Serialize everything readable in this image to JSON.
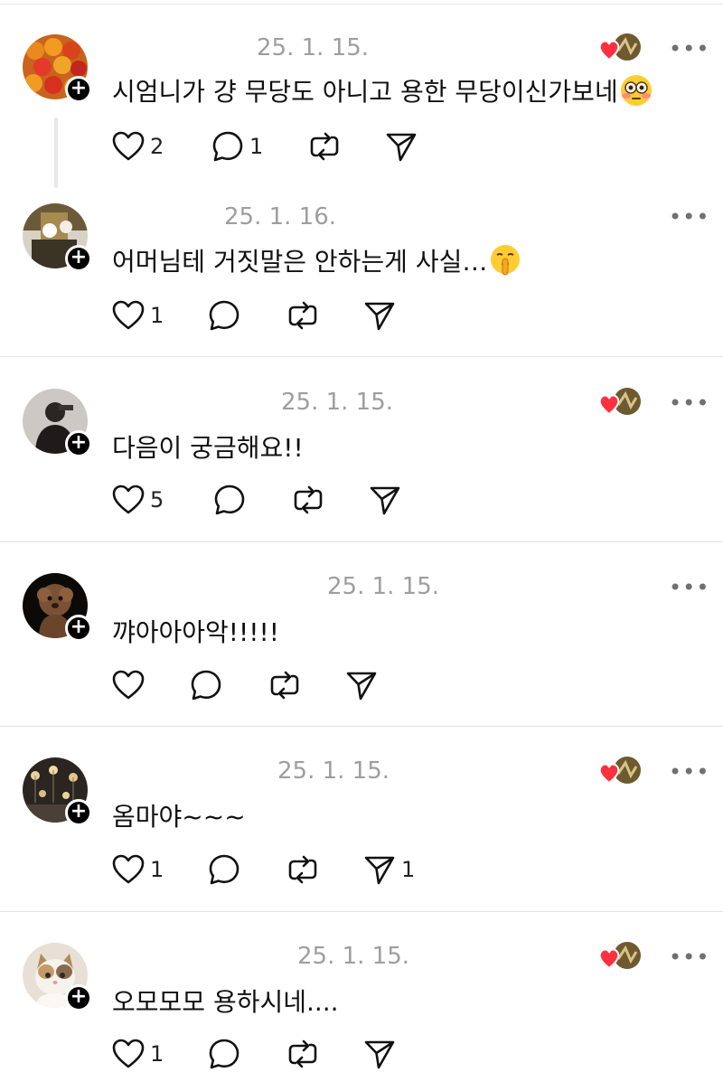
{
  "comments": [
    {
      "date": "25. 1. 15.",
      "text": "시엄니가 걍 무당도 아니고 용한 무당이신가보네",
      "emoji": "flushed-face",
      "creator_liked": true,
      "likes": "2",
      "replies": "1",
      "reposts": "",
      "shares": ""
    },
    {
      "date": "25. 1. 16.",
      "text": "어머님테 거짓말은 안하는게 사실…",
      "emoji": "shushing-face",
      "creator_liked": false,
      "likes": "1",
      "replies": "",
      "reposts": "",
      "shares": ""
    },
    {
      "date": "25. 1. 15.",
      "text": "다음이 궁금해요!!",
      "emoji": "",
      "creator_liked": true,
      "likes": "5",
      "replies": "",
      "reposts": "",
      "shares": ""
    },
    {
      "date": "25. 1. 15.",
      "text": "꺄아아아악!!!!!",
      "emoji": "",
      "creator_liked": false,
      "likes": "",
      "replies": "",
      "reposts": "",
      "shares": ""
    },
    {
      "date": "25. 1. 15.",
      "text": "옴마야~~~",
      "emoji": "",
      "creator_liked": true,
      "likes": "1",
      "replies": "",
      "reposts": "",
      "shares": "1"
    },
    {
      "date": "25. 1. 15.",
      "text": "오모모모 용하시네....",
      "emoji": "",
      "creator_liked": true,
      "likes": "1",
      "replies": "",
      "reposts": "",
      "shares": ""
    }
  ],
  "more_label": "•••",
  "follow_label": "+",
  "colors": {
    "heart_red": "#ff3040",
    "date_gray": "#9e9e9e",
    "icon_black": "#111111"
  }
}
